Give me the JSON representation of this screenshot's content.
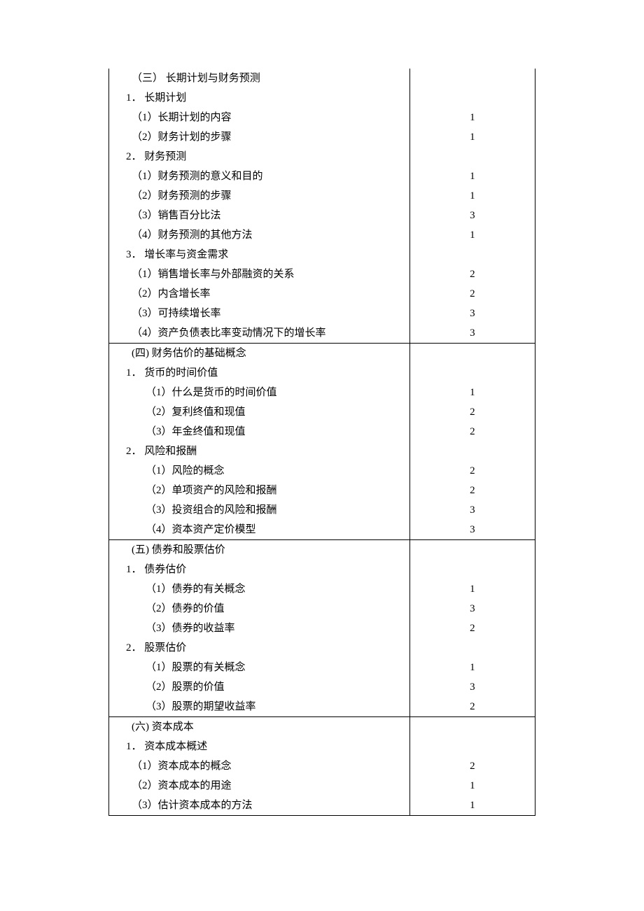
{
  "sections": [
    {
      "rows": [
        {
          "t": "（三）  长期计划与财务预测",
          "n": "",
          "cls": "pad-h0"
        },
        {
          "t": "1．  长期计划",
          "n": "",
          "cls": "pad-h1"
        },
        {
          "t": "（1）长期计划的内容",
          "n": "1",
          "cls": "pad-h2"
        },
        {
          "t": "（2）财务计划的步骤",
          "n": "1",
          "cls": "pad-h2"
        },
        {
          "t": "2．  财务预测",
          "n": "",
          "cls": "pad-h1"
        },
        {
          "t": "（1）财务预测的意义和目的",
          "n": "1",
          "cls": "pad-h2"
        },
        {
          "t": "（2）财务预测的步骤",
          "n": "1",
          "cls": "pad-h2"
        },
        {
          "t": "（3）销售百分比法",
          "n": "3",
          "cls": "pad-h2"
        },
        {
          "t": "（4）财务预测的其他方法",
          "n": "1",
          "cls": "pad-h2"
        },
        {
          "t": "3．  增长率与资金需求",
          "n": "",
          "cls": "pad-h1"
        },
        {
          "t": "（1）销售增长率与外部融资的关系",
          "n": "2",
          "cls": "pad-h2"
        },
        {
          "t": "（2）内含增长率",
          "n": "2",
          "cls": "pad-h2"
        },
        {
          "t": "（3）可持续增长率",
          "n": "3",
          "cls": "pad-h2"
        },
        {
          "t": "（4）资产负债表比率变动情况下的增长率",
          "n": "3",
          "cls": "pad-h2"
        }
      ]
    },
    {
      "rows": [
        {
          "t": "(四)   财务估价的基础概念",
          "n": "",
          "cls": "pad-h0"
        },
        {
          "t": "1．  货币的时间价值",
          "n": "",
          "cls": "pad-h1"
        },
        {
          "t": "（1）什么是货币的时间价值",
          "n": "1",
          "cls": "pad-h3"
        },
        {
          "t": "（2）复利终值和现值",
          "n": "2",
          "cls": "pad-h3"
        },
        {
          "t": "（3）年金终值和现值",
          "n": "2",
          "cls": "pad-h3"
        },
        {
          "t": "2．  风险和报酬",
          "n": "",
          "cls": "pad-h1"
        },
        {
          "t": "（1）风险的概念",
          "n": "2",
          "cls": "pad-h3"
        },
        {
          "t": "（2）单项资产的风险和报酬",
          "n": "2",
          "cls": "pad-h3"
        },
        {
          "t": "（3）投资组合的风险和报酬",
          "n": "3",
          "cls": "pad-h3"
        },
        {
          "t": "（4）资本资产定价模型",
          "n": "3",
          "cls": "pad-h3"
        }
      ]
    },
    {
      "rows": [
        {
          "t": "(五)   债券和股票估价",
          "n": "",
          "cls": "pad-h0"
        },
        {
          "t": "1．  债券估价",
          "n": "",
          "cls": "pad-h1"
        },
        {
          "t": "（1）债券的有关概念",
          "n": "1",
          "cls": "pad-h3"
        },
        {
          "t": "（2）债券的价值",
          "n": "3",
          "cls": "pad-h3"
        },
        {
          "t": "（3）债券的收益率",
          "n": "2",
          "cls": "pad-h3"
        },
        {
          "t": "2．  股票估价",
          "n": "",
          "cls": "pad-h1"
        },
        {
          "t": "（1）股票的有关概念",
          "n": "1",
          "cls": "pad-h3"
        },
        {
          "t": "（2）股票的价值",
          "n": "3",
          "cls": "pad-h3"
        },
        {
          "t": "（3）股票的期望收益率",
          "n": "2",
          "cls": "pad-h3"
        }
      ]
    },
    {
      "rows": [
        {
          "t": "(六)   资本成本",
          "n": "",
          "cls": "pad-h0"
        },
        {
          "t": "1．  资本成本概述",
          "n": "",
          "cls": "pad-h1"
        },
        {
          "t": "（1）资本成本的概念",
          "n": "2",
          "cls": "pad-h2"
        },
        {
          "t": "（2）资本成本的用途",
          "n": "1",
          "cls": "pad-h2"
        },
        {
          "t": "（3）估计资本成本的方法",
          "n": "1",
          "cls": "pad-h2"
        }
      ]
    }
  ]
}
